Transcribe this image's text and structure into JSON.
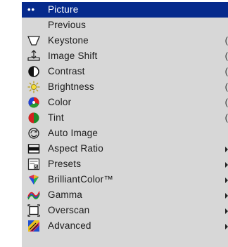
{
  "menu": {
    "items": [
      {
        "label": "Picture",
        "selected": true,
        "icon": "dots-icon"
      },
      {
        "label": "Previous",
        "icon": ""
      },
      {
        "label": "Keystone",
        "icon": "keystone-icon",
        "value": "("
      },
      {
        "label": "Image Shift",
        "icon": "image-shift-icon",
        "value": "("
      },
      {
        "label": "Contrast",
        "icon": "contrast-icon",
        "value": "("
      },
      {
        "label": "Brightness",
        "icon": "brightness-icon",
        "value": "("
      },
      {
        "label": "Color",
        "icon": "color-icon",
        "value": "("
      },
      {
        "label": "Tint",
        "icon": "tint-icon",
        "value": "("
      },
      {
        "label": "Auto Image",
        "icon": "auto-image-icon"
      },
      {
        "label": "Aspect Ratio",
        "icon": "aspect-ratio-icon",
        "submenu": true
      },
      {
        "label": "Presets",
        "icon": "presets-icon",
        "submenu": true
      },
      {
        "label": "BrilliantColor™",
        "icon": "brilliantcolor-icon",
        "submenu": true
      },
      {
        "label": "Gamma",
        "icon": "gamma-icon",
        "submenu": true
      },
      {
        "label": "Overscan",
        "icon": "overscan-icon",
        "submenu": true
      },
      {
        "label": "Advanced",
        "icon": "advanced-icon",
        "submenu": true
      }
    ],
    "selected_bg": "#062a8c",
    "bg": "#d7d7d7"
  }
}
